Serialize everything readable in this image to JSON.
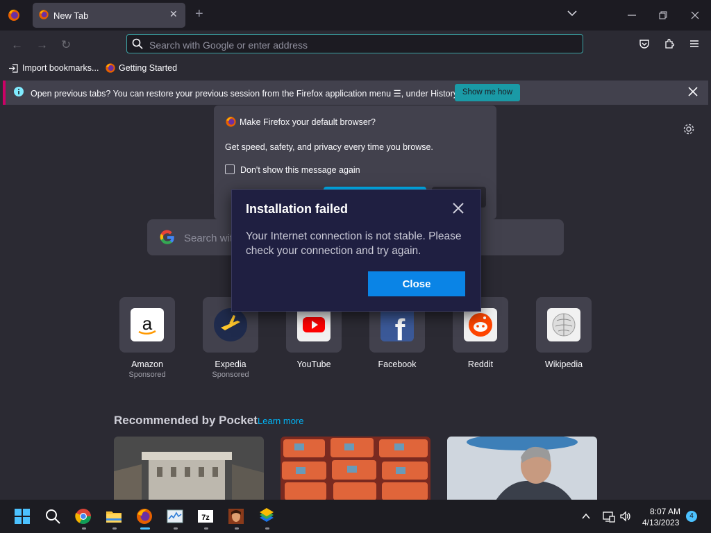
{
  "browser": {
    "tab_title": "New Tab",
    "url_placeholder": "Search with Google or enter address",
    "bookmarks": [
      "Import bookmarks...",
      "Getting Started"
    ]
  },
  "notification": {
    "message": "Open previous tabs? You can restore your previous session from the Firefox application menu ☰, under History.",
    "button_label": "Show me how"
  },
  "default_browser_prompt": {
    "title": "Make Firefox your default browser?",
    "body": "Get speed, safety, and privacy every time you browse.",
    "checkbox_label": "Don't show this message again"
  },
  "search": {
    "placeholder": "Search wit"
  },
  "top_sites": [
    {
      "label": "Amazon",
      "sub": "Sponsored"
    },
    {
      "label": "Expedia",
      "sub": "Sponsored"
    },
    {
      "label": "YouTube",
      "sub": ""
    },
    {
      "label": "Facebook",
      "sub": ""
    },
    {
      "label": "Reddit",
      "sub": ""
    },
    {
      "label": "Wikipedia",
      "sub": ""
    }
  ],
  "pocket": {
    "title": "Recommended by Pocket",
    "learn_more": "Learn more"
  },
  "error_dialog": {
    "title": "Installation failed",
    "message": "Your Internet connection is not stable. Please check your connection and try again.",
    "close_label": "Close"
  },
  "taskbar": {
    "time": "8:07 AM",
    "date": "4/13/2023",
    "notification_count": "4",
    "apps": [
      "start-icon",
      "search-icon",
      "chrome-icon",
      "file-explorer-icon",
      "firefox-icon",
      "task-manager-icon",
      "7zip-icon",
      "game-icon",
      "bluestacks-icon"
    ]
  },
  "colors": {
    "accent": "#00b3f4",
    "modal_bg": "#1f1f41",
    "button_blue": "#0a84e6",
    "chrome_bg": "#2b2a33"
  }
}
